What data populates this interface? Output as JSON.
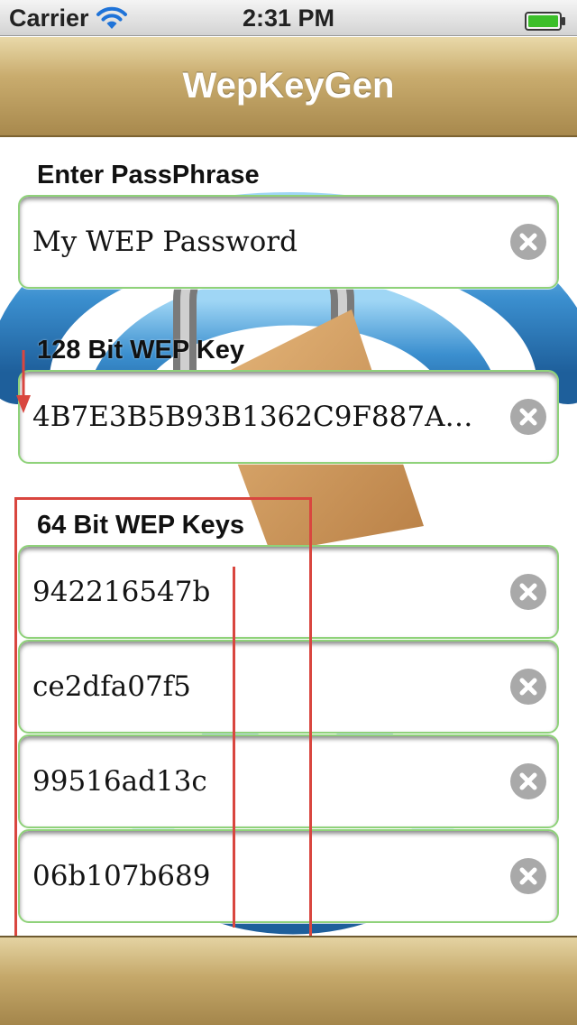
{
  "status_bar": {
    "carrier": "Carrier",
    "time": "2:31 PM",
    "wifi_icon": "wifi-icon",
    "battery_icon": "battery-icon",
    "battery_color": "#3cbf2a"
  },
  "nav": {
    "title": "WepKeyGen"
  },
  "passphrase": {
    "label": "Enter PassPhrase",
    "value": "My WEP Password"
  },
  "key128": {
    "label": "128 Bit WEP Key",
    "value": "4B7E3B5B93B1362C9F887A9..."
  },
  "keys64": {
    "label": "64 Bit WEP Keys",
    "values": [
      "942216547b",
      "ce2dfa07f5",
      "99516ad13c",
      "06b107b689"
    ]
  },
  "colors": {
    "nav_gold": "#c9ac6e",
    "field_border": "#8fd27a",
    "annotation": "#d9463f"
  }
}
